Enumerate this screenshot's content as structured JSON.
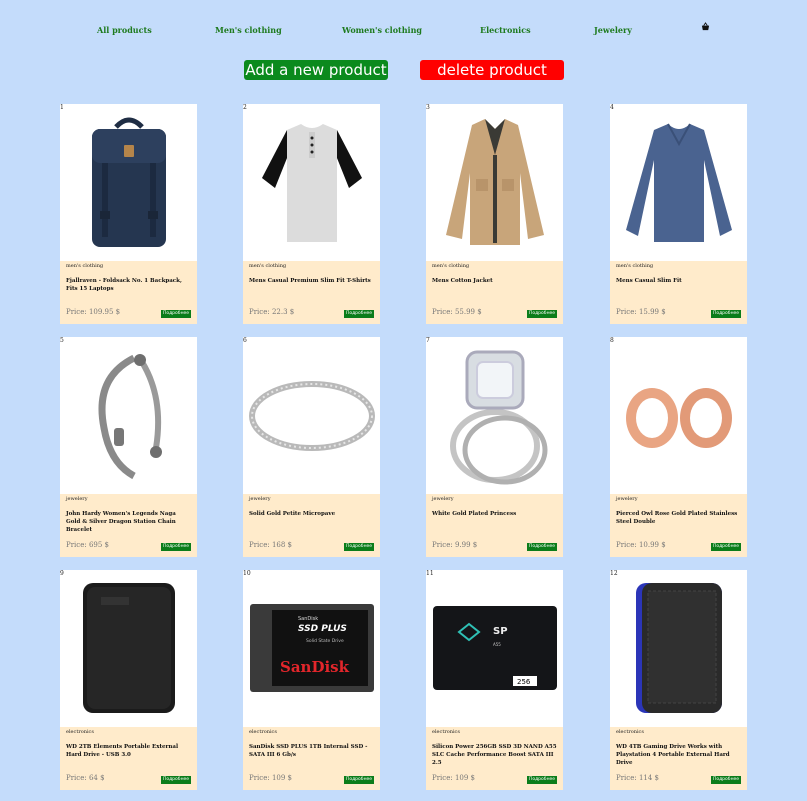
{
  "nav": {
    "items": [
      "All products",
      "Men's clothing",
      "Women's clothing",
      "Electronics",
      "Jewelery"
    ],
    "cart_icon": "shopping-basket-icon"
  },
  "actions": {
    "add_label": "Add a new product",
    "delete_label": "delete product",
    "add_color": "#0b8a1d",
    "delete_color": "#ff0000"
  },
  "products": [
    {
      "num": "1",
      "category": "men's clothing",
      "title": "Fjallraven - Foldsack No. 1 Backpack, Fits 15 Laptops",
      "price": "Price: 109.95 $",
      "buy": "Подробнее",
      "image": "backpack"
    },
    {
      "num": "2",
      "category": "men's clothing",
      "title": "Mens Casual Premium Slim Fit T-Shirts",
      "price": "Price: 22.3 $",
      "buy": "Подробнее",
      "image": "tshirt"
    },
    {
      "num": "3",
      "category": "men's clothing",
      "title": "Mens Cotton Jacket",
      "price": "Price: 55.99 $",
      "buy": "Подробнее",
      "image": "jacket"
    },
    {
      "num": "4",
      "category": "men's clothing",
      "title": "Mens Casual Slim Fit",
      "price": "Price: 15.99 $",
      "buy": "Подробнее",
      "image": "longsleeve"
    },
    {
      "num": "5",
      "category": "jewelery",
      "title": "John Hardy Women's Legends Naga Gold & Silver Dragon Station Chain Bracelet",
      "price": "Price: 695 $",
      "buy": "Подробнее",
      "image": "bracelet"
    },
    {
      "num": "6",
      "category": "jewelery",
      "title": "Solid Gold Petite Micropave",
      "price": "Price: 168 $",
      "buy": "Подробнее",
      "image": "ring"
    },
    {
      "num": "7",
      "category": "jewelery",
      "title": "White Gold Plated Princess",
      "price": "Price: 9.99 $",
      "buy": "Подробнее",
      "image": "diamond-ring"
    },
    {
      "num": "8",
      "category": "jewelery",
      "title": "Pierced Owl Rose Gold Plated Stainless Steel Double",
      "price": "Price: 10.99 $",
      "buy": "Подробнее",
      "image": "plugs"
    },
    {
      "num": "9",
      "category": "electronics",
      "title": "WD 2TB Elements Portable External Hard Drive - USB 3.0",
      "price": "Price: 64 $",
      "buy": "Подробнее",
      "image": "hdd-black"
    },
    {
      "num": "10",
      "category": "electronics",
      "title": "SanDisk SSD PLUS 1TB Internal SSD - SATA III 6 Gb/s",
      "price": "Price: 109 $",
      "buy": "Подробнее",
      "image": "sandisk"
    },
    {
      "num": "11",
      "category": "electronics",
      "title": "Silicon Power 256GB SSD 3D NAND A55 SLC Cache Performance Boost SATA III 2.5",
      "price": "Price: 109 $",
      "buy": "Подробнее",
      "image": "sp-ssd"
    },
    {
      "num": "12",
      "category": "electronics",
      "title": "WD 4TB Gaming Drive Works with Playstation 4 Portable External Hard Drive",
      "price": "Price: 114 $",
      "buy": "Подробнее",
      "image": "hdd-gaming"
    }
  ],
  "image_texts": {
    "sandisk_line1": "SanDisk",
    "sandisk_line2": "SSD PLUS",
    "sandisk_line3": "Solid State Drive",
    "sandisk_brand": "SanDisk",
    "sp_logo": "SP",
    "sp_model": "A55",
    "sp_capacity": "256"
  }
}
